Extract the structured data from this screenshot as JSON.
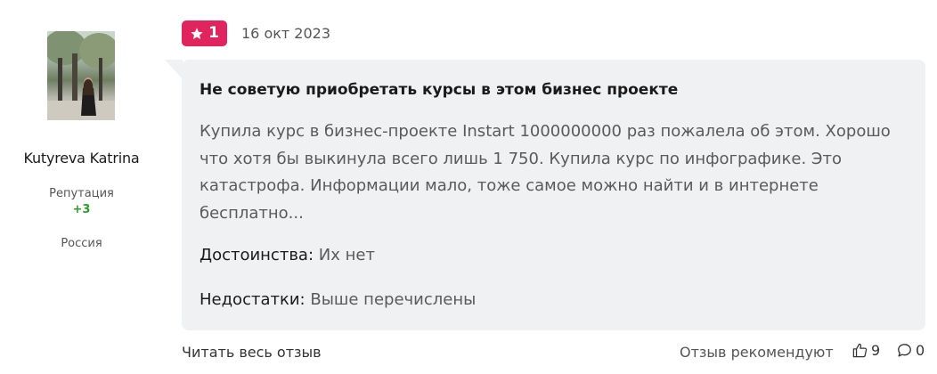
{
  "author": {
    "name": "Kutyreva Katrina",
    "reputation_label": "Репутация",
    "reputation_value": "+3",
    "country": "Россия"
  },
  "review": {
    "rating": "1",
    "date": "16 окт 2023",
    "title": "Не советую приобретать курсы в этом бизнес проекте",
    "text": "Купила курс в бизнес-проекте Instart 1000000000 раз пожалела об этом. Хорошо что хотя бы выкинула всего лишь 1 750. Купила курс по инфографике. Это катастрофа. Информации мало, тоже самое можно найти и в интернете бесплатно...",
    "pros_label": "Достоинства:",
    "pros_value": "Их нет",
    "cons_label": "Недостатки:",
    "cons_value": "Выше перечислены"
  },
  "footer": {
    "read_full": "Читать весь отзыв",
    "recommend_label": "Отзыв рекомендуют",
    "likes": "9",
    "comments": "0"
  },
  "colors": {
    "rating_badge": "#e0245e",
    "reputation_positive": "#2e9b2e",
    "bubble_bg": "#f0f1f3"
  },
  "icons": {
    "rating": "star-icon",
    "likes": "thumbs-up-icon",
    "comments": "speech-bubble-icon"
  }
}
